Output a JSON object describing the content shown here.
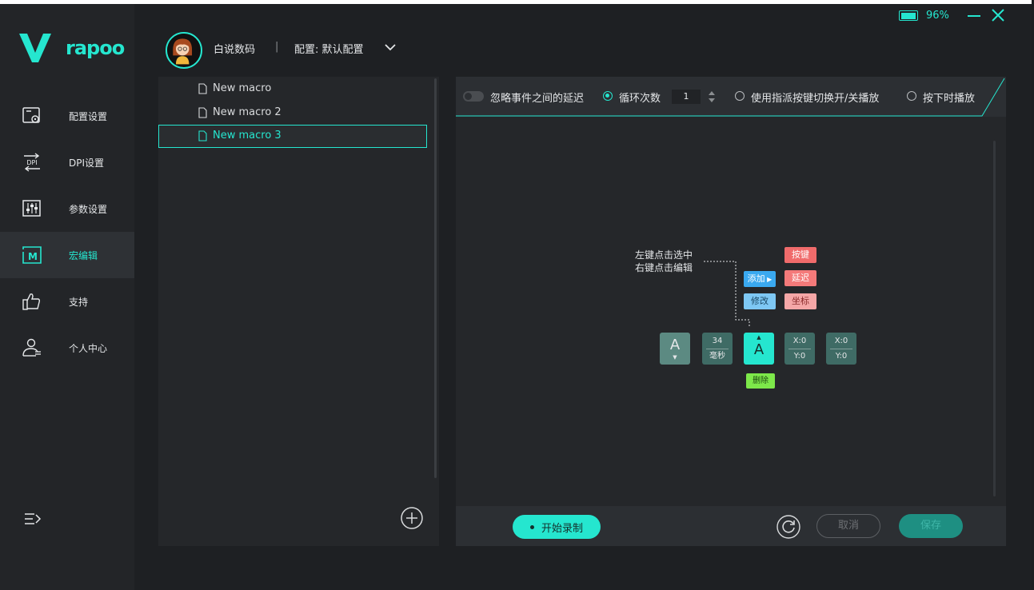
{
  "app": {
    "brand": "rapoo",
    "battery_pct": "96%",
    "battery_level": 0.96
  },
  "colors": {
    "accent": "#25e6cf",
    "background": "#1e2023",
    "panel": "#25272a",
    "key_tag": "#f06b6b",
    "add_tag": "#3aa9f0",
    "delete_tag": "#7de84a"
  },
  "header": {
    "user_name": "白说数码",
    "separator": "|",
    "profile_label": "配置: 默认配置"
  },
  "sidebar": {
    "items": [
      {
        "label": "配置设置",
        "icon": "profile-settings-icon"
      },
      {
        "label": "DPI设置",
        "icon": "dpi-icon"
      },
      {
        "label": "参数设置",
        "icon": "sliders-icon"
      },
      {
        "label": "宏编辑",
        "icon": "macro-icon",
        "active": true
      },
      {
        "label": "支持",
        "icon": "thumbs-up-icon"
      },
      {
        "label": "个人中心",
        "icon": "user-icon"
      }
    ],
    "dpi_icon_text": "DPI",
    "macro_icon_text": "M"
  },
  "macros": {
    "items": [
      "New macro",
      "New macro 2",
      "New macro 3"
    ],
    "selected": "New macro 3"
  },
  "options": {
    "ignore_delay_label": "忽略事件之间的延迟",
    "loop_label": "循环次数",
    "loop_count": "1",
    "toggle_assign_label": "使用指派按键切换开/关播放",
    "hold_play_label": "按下时播放"
  },
  "diagram": {
    "hint_line1": "左键点击选中",
    "hint_line2": "右键点击编辑",
    "add_label": "添加",
    "modify_label": "修改",
    "key_label": "按键",
    "delay_label": "延迟",
    "coord_label": "坐标",
    "delete_label": "删除",
    "tiles": {
      "key_down": "A",
      "delay_value": "34",
      "delay_unit": "毫秒",
      "key_up": "A",
      "coord1_x": "X:0",
      "coord1_y": "Y:0",
      "coord2_x": "X:0",
      "coord2_y": "Y:0"
    }
  },
  "bottom": {
    "record_label": "开始录制",
    "cancel_label": "取消",
    "save_label": "保存"
  }
}
